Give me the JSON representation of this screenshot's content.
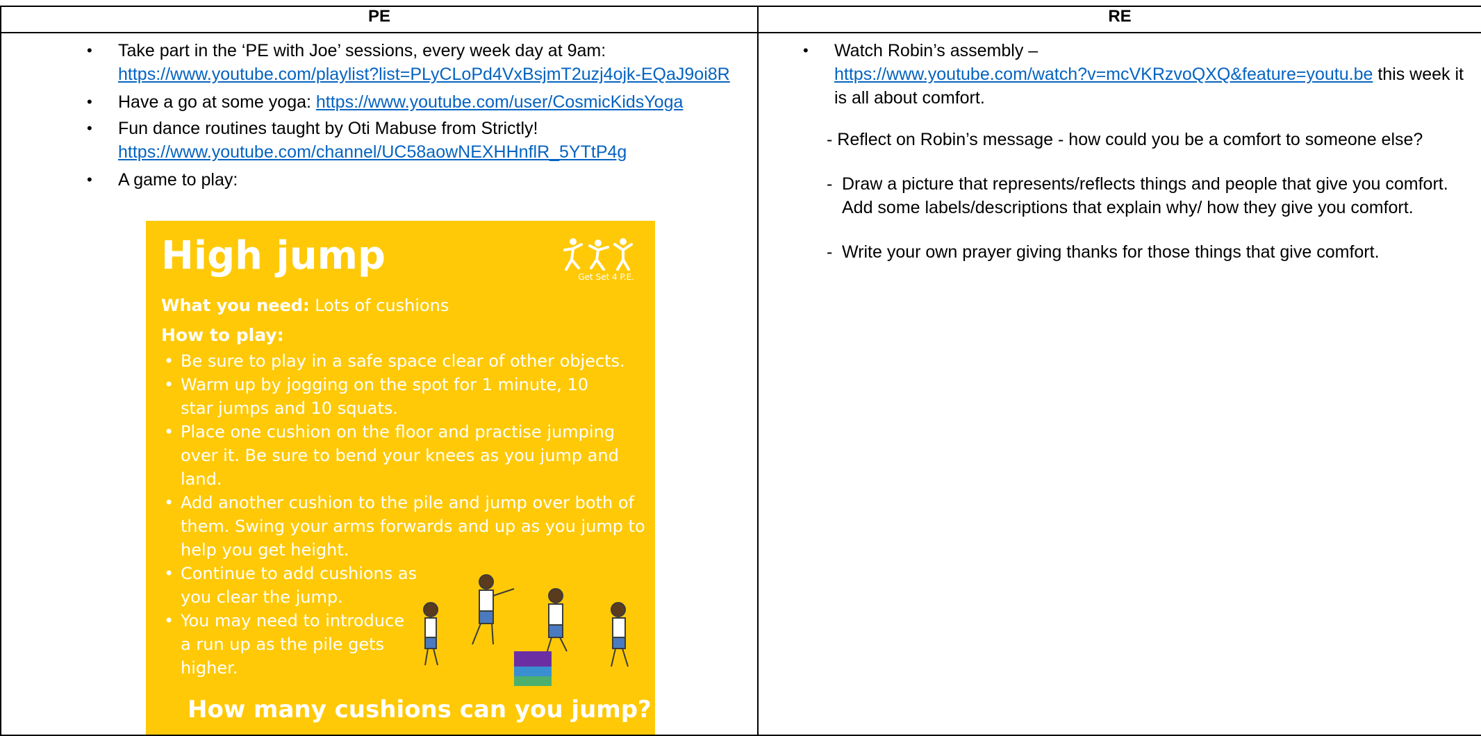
{
  "headers": {
    "pe": "PE",
    "re": "RE"
  },
  "pe": {
    "b1_text": "Take part in the ‘PE with Joe’ sessions, every week day at 9am:",
    "b1_link": "https://www.youtube.com/playlist?list=PLyCLoPd4VxBsjmT2uzj4ojk-EQaJ9oi8R",
    "b2_text": "Have a go at some yoga: ",
    "b2_link": "https://www.youtube.com/user/CosmicKidsYoga",
    "b3_text": "Fun dance routines taught by Oti Mabuse from Strictly!",
    "b3_link": "https://www.youtube.com/channel/UC58aowNEXHHnflR_5YTtP4g",
    "b4_text": "A game to play:",
    "poster": {
      "title": "High jump",
      "logo_text": "Get Set 4 P.E.",
      "need_label": "What you need:",
      "need_value": " Lots of cushions",
      "how_label": "How to play:",
      "steps": [
        "Be sure to play in a safe space clear of other objects.",
        "Warm up by jogging on the spot for 1 minute, 10 star jumps and 10 squats.",
        "Place one cushion on the floor and practise jumping over it. Be sure to bend your knees as you jump and land.",
        "Add another cushion to the pile and jump over both of them. Swing your arms forwards and up as you jump to help you get height.",
        "Continue to add cushions as you clear the jump.",
        "You may need to introduce a run up as the pile gets higher."
      ],
      "bottom": "How many cushions can you jump?"
    }
  },
  "re": {
    "b1_text": "Watch Robin’s assembly –",
    "b1_link": "https://www.youtube.com/watch?v=mcVKRzvoQXQ&feature=youtu.be",
    "b1_after": " this week it is all about comfort.",
    "d1": "- Reflect on Robin’s message - how could you be a comfort to someone else?",
    "d2_dash": "-",
    "d2": "Draw a picture that represents/reflects things and people that give you comfort. Add some labels/descriptions that explain why/ how they give you comfort.",
    "d3_dash": "-",
    "d3": "Write your own prayer giving thanks for those things that give comfort."
  },
  "colors": {
    "link": "#0563c1",
    "poster_bg": "#ffc907"
  },
  "icons": {
    "bullet": "•"
  }
}
